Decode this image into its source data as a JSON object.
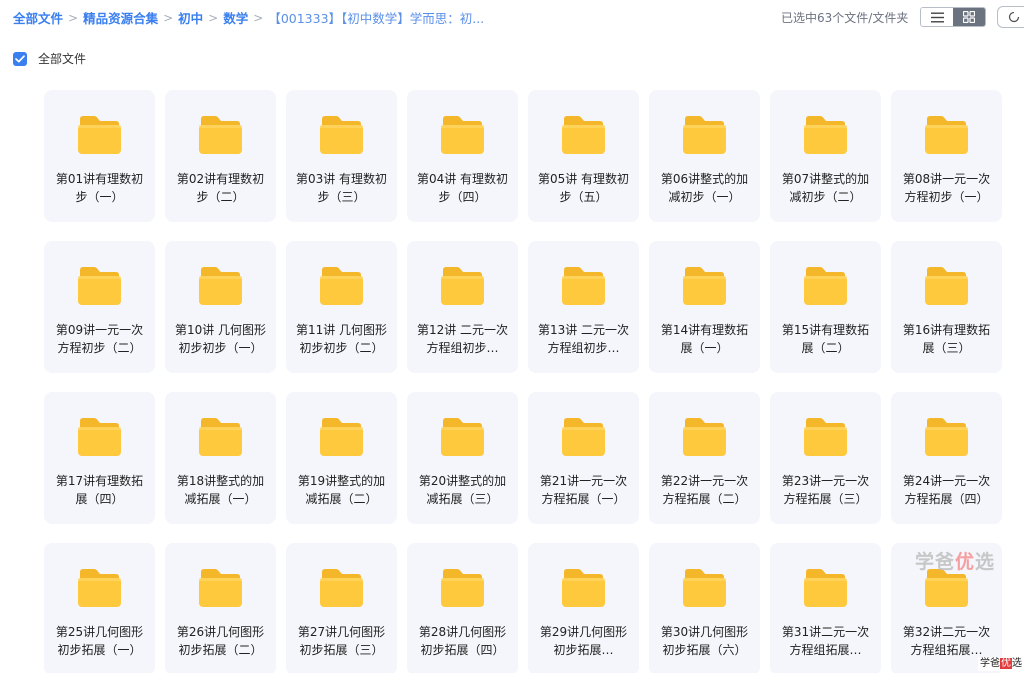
{
  "breadcrumb": {
    "items": [
      "全部文件",
      "精品资源合集",
      "初中",
      "数学"
    ],
    "current": "【001333】【初中数学】学而思：初..."
  },
  "toolbar": {
    "selection_status": "已选中63个文件/文件夹",
    "views": [
      "list-view",
      "grid-view"
    ],
    "active_view": "grid-view"
  },
  "select_all": {
    "label": "全部文件",
    "checked": true
  },
  "colors": {
    "accent": "#3a7ff0",
    "folder": "#ffc93e",
    "card_bg": "#f4f6fb"
  },
  "folders": [
    "第01讲有理数初步（一）",
    "第02讲有理数初步（二）",
    "第03讲 有理数初步（三）",
    "第04讲 有理数初步（四）",
    "第05讲 有理数初步（五）",
    "第06讲整式的加减初步（一）",
    "第07讲整式的加减初步（二）",
    "第08讲一元一次方程初步（一）",
    "第09讲一元一次方程初步（二）",
    "第10讲 几何图形初步初步（一）",
    "第11讲 几何图形初步初步（二）",
    "第12讲 二元一次方程组初步…",
    "第13讲 二元一次方程组初步…",
    "第14讲有理数拓展（一）",
    "第15讲有理数拓展（二）",
    "第16讲有理数拓展（三）",
    "第17讲有理数拓展（四）",
    "第18讲整式的加减拓展（一）",
    "第19讲整式的加减拓展（二）",
    "第20讲整式的加减拓展（三）",
    "第21讲一元一次方程拓展（一）",
    "第22讲一元一次方程拓展（二）",
    "第23讲一元一次方程拓展（三）",
    "第24讲一元一次方程拓展（四）",
    "第25讲几何图形初步拓展（一）",
    "第26讲几何图形初步拓展（二）",
    "第27讲几何图形初步拓展（三）",
    "第28讲几何图形初步拓展（四）",
    "第29讲几何图形初步拓展…",
    "第30讲几何图形初步拓展（六）",
    "第31讲二元一次方程组拓展…",
    "第32讲二元一次方程组拓展…"
  ],
  "watermark": {
    "text_a": "学爸",
    "text_b": "优",
    "text_c": "选",
    "badge_a": "学爸",
    "badge_b": "优",
    "badge_c": "选"
  }
}
